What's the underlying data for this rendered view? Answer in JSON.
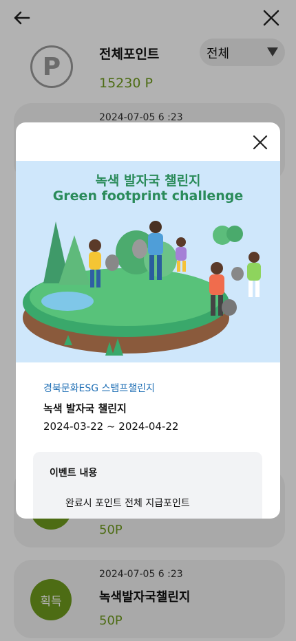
{
  "header": {
    "back_icon": "arrow-left-icon",
    "close_icon": "close-icon"
  },
  "summary": {
    "icon_letter": "P",
    "label": "전체포인트",
    "value": "15230 P",
    "filter_selected": "전체"
  },
  "cards": [
    {
      "date": "2024-07-05 6 :23",
      "title": "",
      "points": "",
      "badge": ""
    },
    {
      "date": "",
      "title": "",
      "points": "50P",
      "badge": ""
    },
    {
      "date": "2024-07-05 6 :23",
      "title": "녹색발자국챌린지",
      "points": "50P",
      "badge": "획득"
    }
  ],
  "modal": {
    "banner_title_ko": "녹색 발자국 챌린지",
    "banner_title_en": "Green footprint challenge",
    "organization": "경북문화ESG 스탬프챌린지",
    "challenge_name": "녹색 발자국 챌린지",
    "period": "2024-03-22 ~ 2024-04-22",
    "event_label": "이벤트 내용",
    "event_text": "완료시 포인트 전체 지급포인트"
  },
  "colors": {
    "accent_green": "#6f9b1d",
    "org_blue": "#1f6fb5",
    "banner_bg": "#cfe7fb"
  }
}
